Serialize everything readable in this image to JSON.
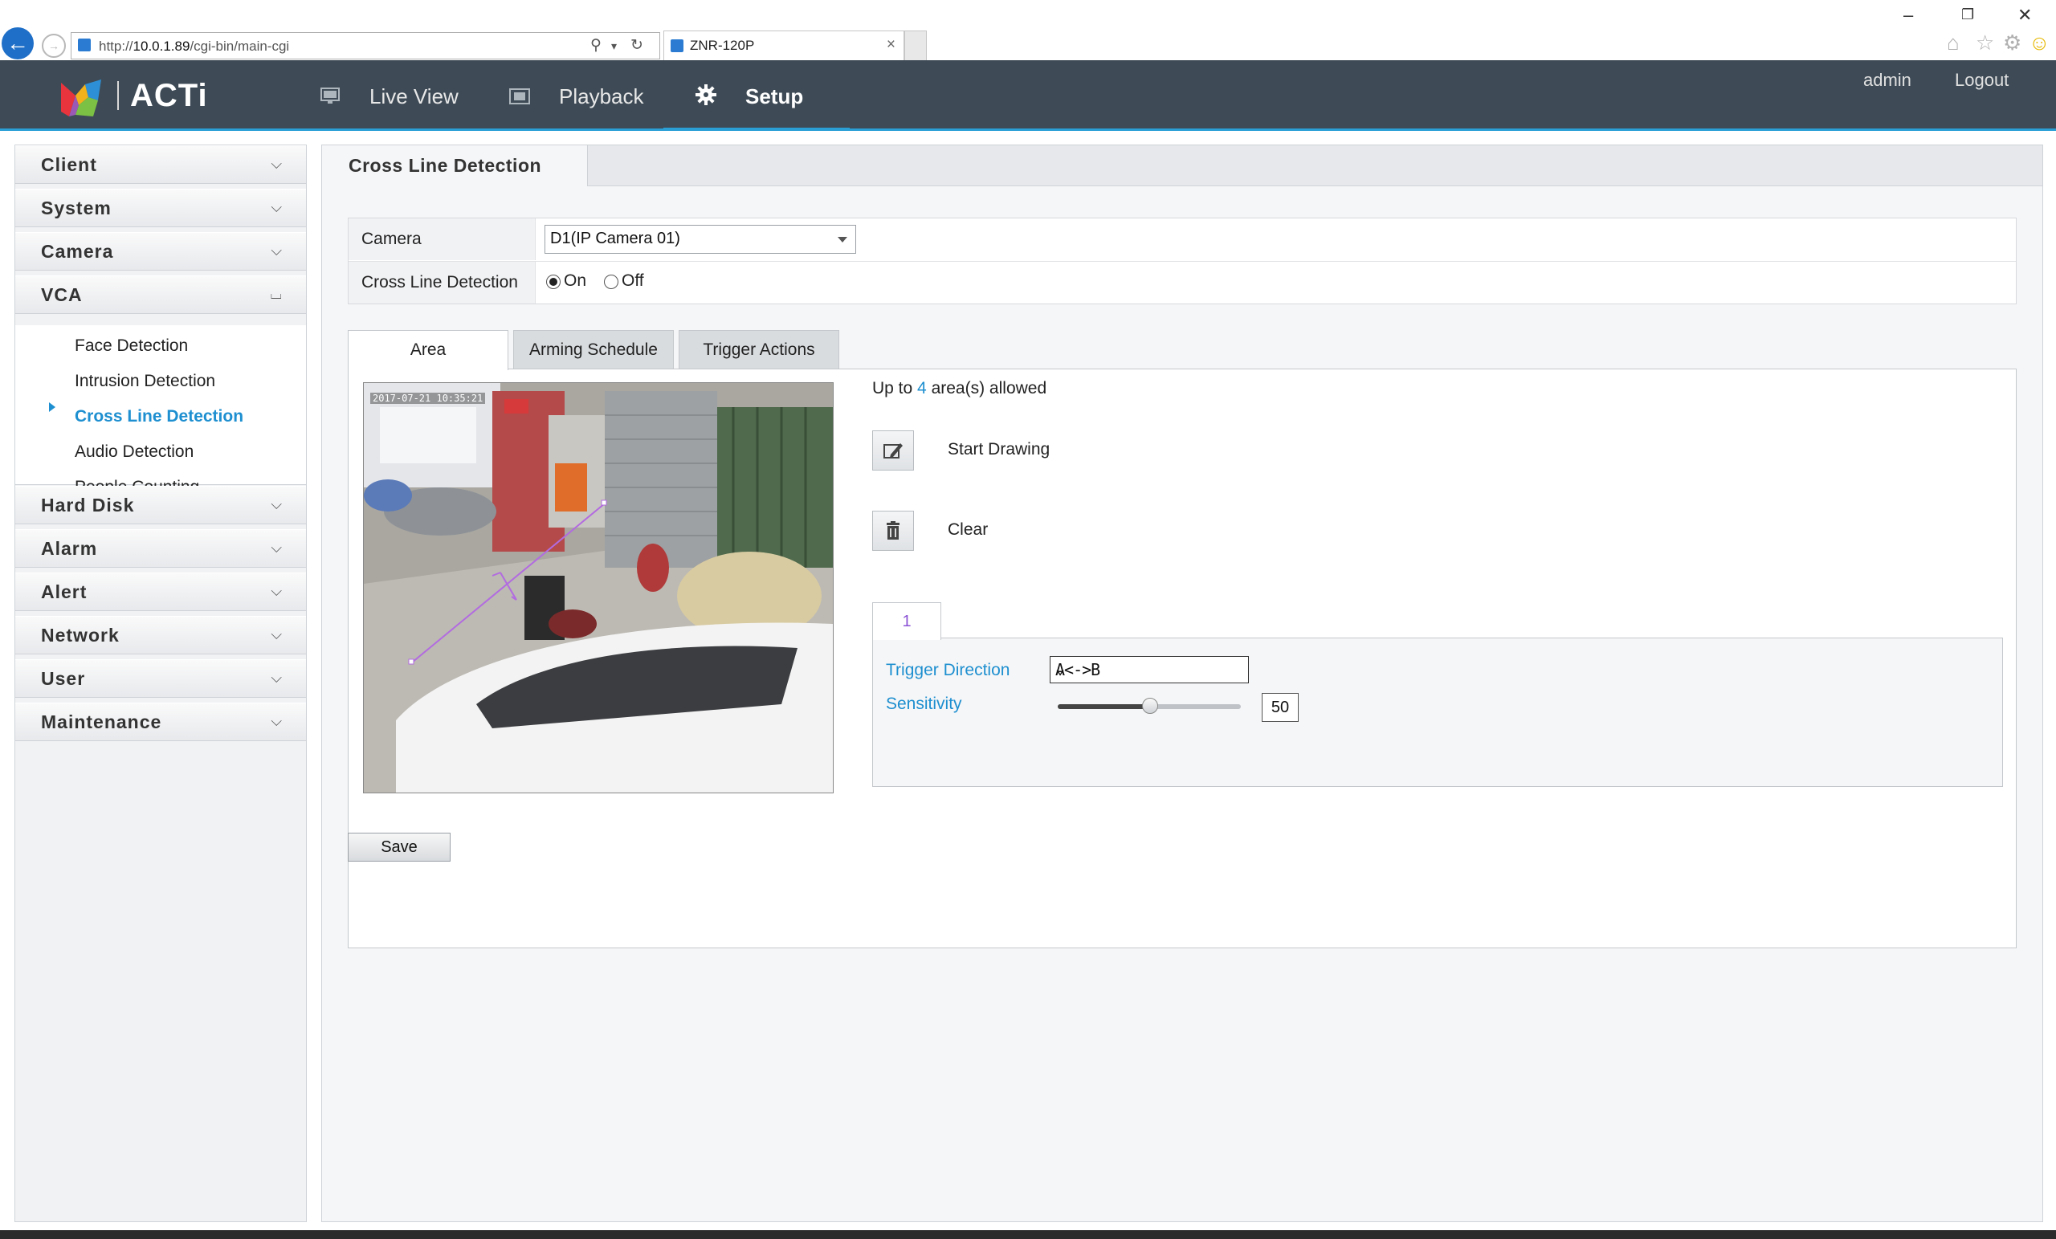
{
  "browser": {
    "url_prefix": "http://",
    "url_host": "10.0.1.89",
    "url_path": "/cgi-bin/main-cgi",
    "tab_title": "ZNR-120P",
    "tab_close": "×"
  },
  "header": {
    "logo_text": "ACTi",
    "nav": [
      {
        "label": "Live View",
        "icon": "monitor-icon"
      },
      {
        "label": "Playback",
        "icon": "film-icon"
      },
      {
        "label": "Setup",
        "icon": "gear-icon"
      }
    ],
    "user": "admin",
    "logout": "Logout"
  },
  "sidebar": {
    "groups": [
      {
        "label": "Client"
      },
      {
        "label": "System"
      },
      {
        "label": "Camera"
      },
      {
        "label": "VCA"
      },
      {
        "label": "Hard Disk"
      },
      {
        "label": "Alarm"
      },
      {
        "label": "Alert"
      },
      {
        "label": "Network"
      },
      {
        "label": "User"
      },
      {
        "label": "Maintenance"
      }
    ],
    "vca_items": [
      {
        "label": "Face Detection"
      },
      {
        "label": "Intrusion Detection"
      },
      {
        "label": "Cross Line Detection"
      },
      {
        "label": "Audio Detection"
      },
      {
        "label": "People Counting"
      }
    ],
    "active_item": "Cross Line Detection"
  },
  "page": {
    "title": "Cross Line Detection",
    "camera_label": "Camera",
    "camera_value": "D1(IP Camera 01)",
    "cld_label": "Cross Line Detection",
    "on_label": "On",
    "off_label": "Off",
    "cld_state": "On",
    "tabs": [
      {
        "label": "Area"
      },
      {
        "label": "Arming Schedule"
      },
      {
        "label": "Trigger Actions"
      }
    ],
    "video_timestamp": "2017-07-21 10:35:21",
    "area_info_pre": "Up to",
    "area_info_num": "4",
    "area_info_post": "area(s) allowed",
    "start_drawing": "Start Drawing",
    "clear": "Clear",
    "area_tab": "1",
    "trigger_direction_label": "Trigger Direction",
    "trigger_direction_value": "A<->B",
    "sensitivity_label": "Sensitivity",
    "sensitivity_value": "50",
    "sensitivity_fraction": 0.5,
    "save": "Save"
  },
  "colors": {
    "header_bg": "#3e4b56",
    "accent": "#2a9fd6",
    "link_blue": "#1e8fd0",
    "area_tab_purple": "#8b52d6"
  }
}
